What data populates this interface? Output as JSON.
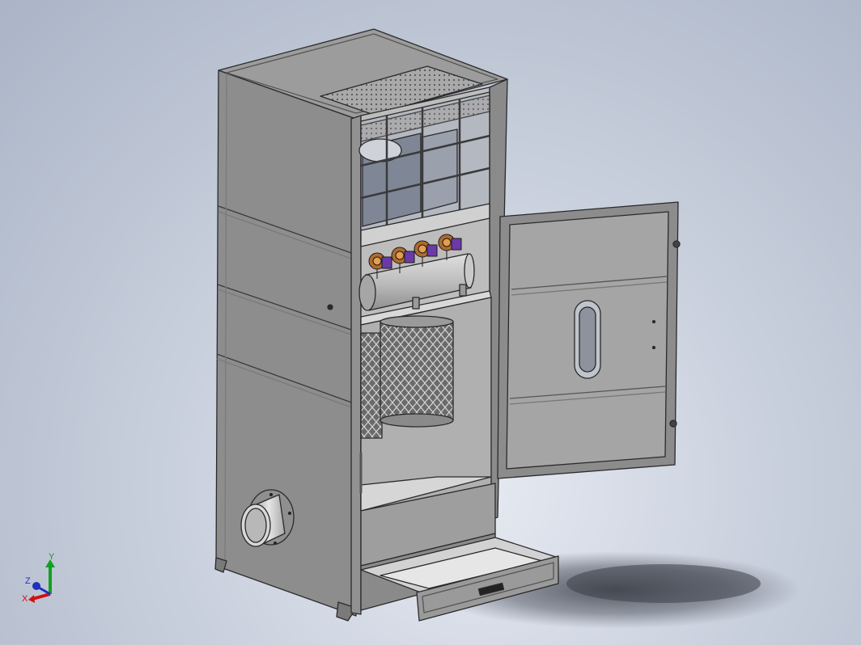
{
  "triad": {
    "y_label": "Y",
    "z_label": "Z",
    "x_label": "X",
    "colors": {
      "x": "#d01010",
      "y": "#10a020",
      "z": "#2030c0"
    }
  },
  "model": {
    "icon": "dust-collector-cabinet-icon",
    "parts": [
      "cabinet",
      "top-mesh-vent",
      "fan-chamber",
      "compressed-air-manifold",
      "pulse-valves",
      "filter-cartridges",
      "open-door",
      "door-sight-window",
      "inlet-duct",
      "dust-drawer",
      "drawer-handle"
    ]
  }
}
